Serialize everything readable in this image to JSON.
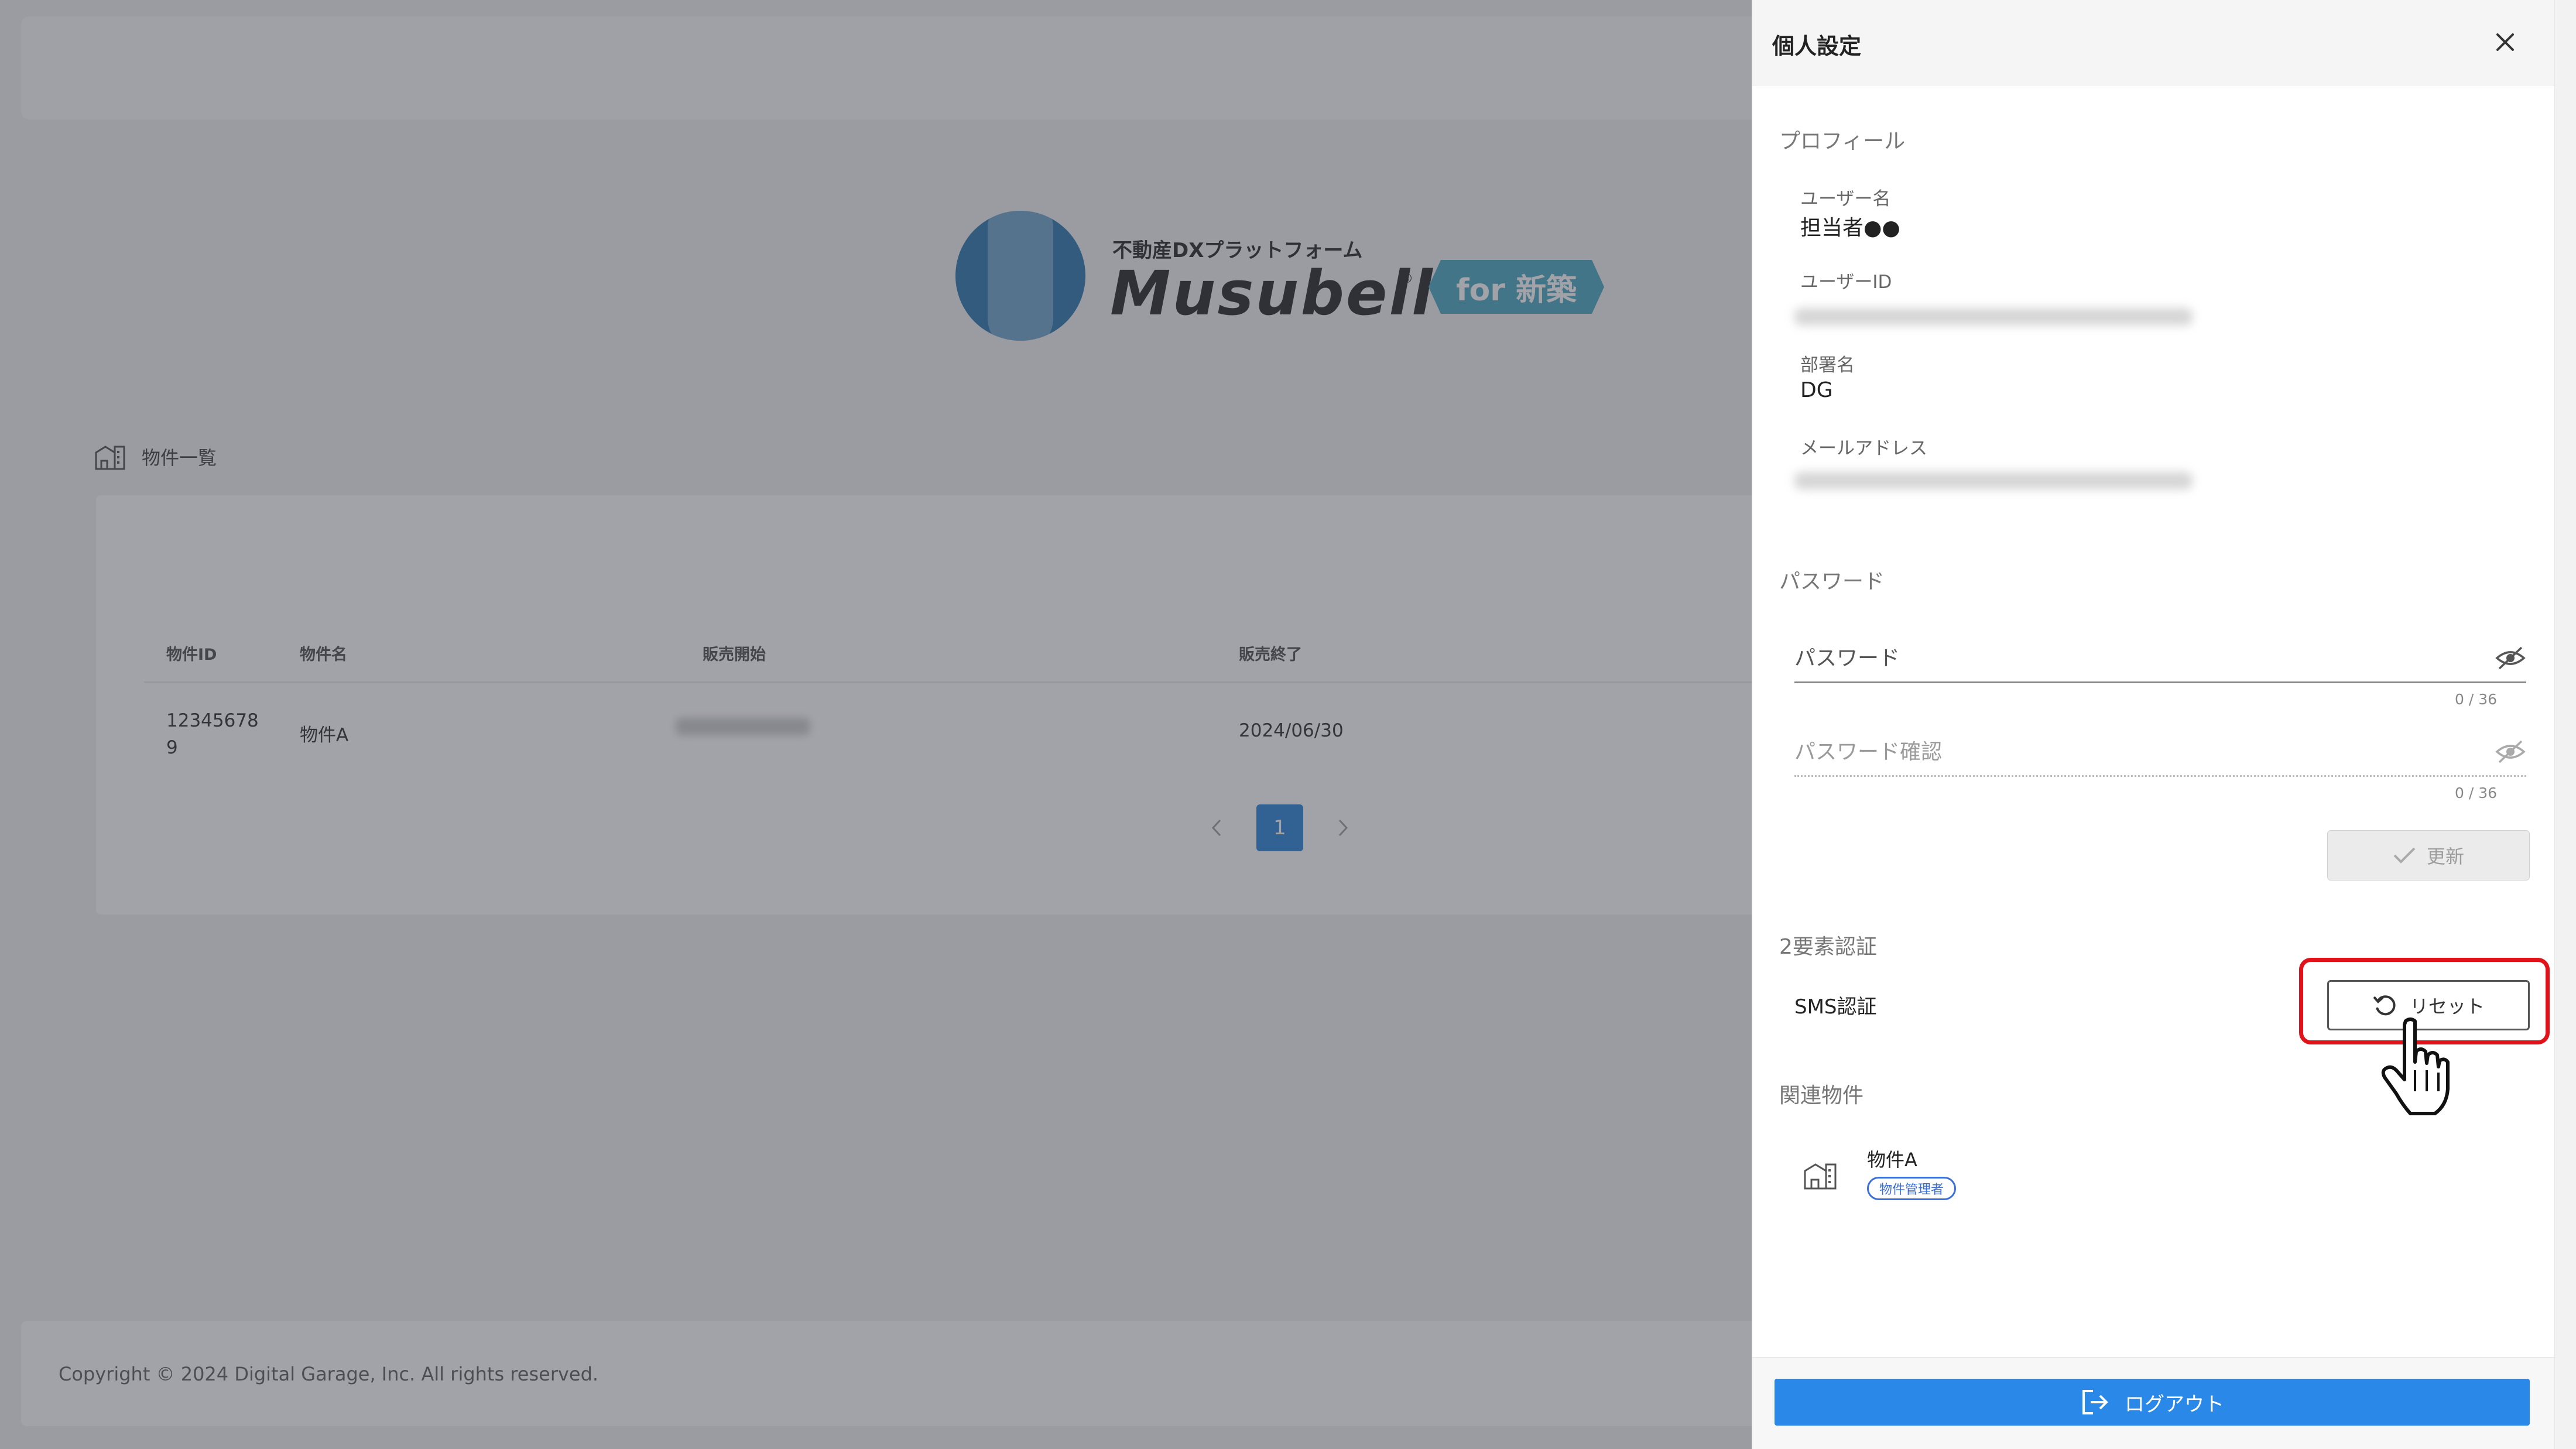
{
  "brand": {
    "tagline": "不動産DXプラットフォーム",
    "name": "Musubell",
    "registered": "®",
    "badge": "for 新築"
  },
  "page": {
    "title": "物件一覧",
    "icon": "building-icon"
  },
  "table": {
    "headers": [
      "物件ID",
      "物件名",
      "販売開始",
      "販売終了"
    ],
    "rows": [
      {
        "id": "123456789",
        "name": "物件A",
        "start": "",
        "end": "2024/06/30"
      }
    ]
  },
  "pagination": {
    "current": "1",
    "prev_icon": "chevron-left-icon",
    "next_icon": "chevron-right-icon"
  },
  "footer": {
    "copyright": "Copyright © 2024 Digital Garage, Inc. All rights reserved."
  },
  "drawer": {
    "title": "個人設定",
    "close_icon": "close-icon",
    "profile": {
      "section_title": "プロフィール",
      "username_label": "ユーザー名",
      "username_value": "担当者●●",
      "userid_label": "ユーザーID",
      "department_label": "部署名",
      "department_value": "DG",
      "email_label": "メールアドレス"
    },
    "password": {
      "section_title": "パスワード",
      "password_placeholder": "パスワード",
      "password_counter": "0 / 36",
      "confirm_placeholder": "パスワード確認",
      "confirm_counter": "0 / 36",
      "update_label": "更新"
    },
    "two_factor": {
      "section_title": "2要素認証",
      "sms_label": "SMS認証",
      "reset_label": "リセット"
    },
    "related": {
      "section_title": "関連物件",
      "item_name": "物件A",
      "item_role": "物件管理者"
    },
    "logout_label": "ログアウト"
  },
  "colors": {
    "primary": "#2a88e8",
    "highlight": "#e0131b",
    "badge": "#3fa2be",
    "brand_blue": "#1e6ea8"
  }
}
